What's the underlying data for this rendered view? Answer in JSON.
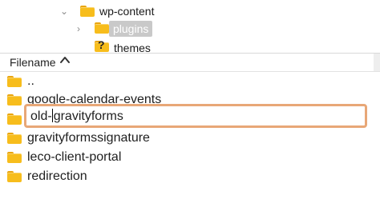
{
  "tree": {
    "items": [
      {
        "label": "wp-content",
        "icon": "folder-icon",
        "expanded": true
      },
      {
        "label": "plugins",
        "icon": "folder-icon",
        "selected": true
      },
      {
        "label": "themes",
        "icon": "question-folder-icon"
      }
    ]
  },
  "file_list": {
    "column_header": "Filename",
    "sort": "ascending",
    "rows": [
      {
        "name": ".."
      },
      {
        "name": "google-calendar-events"
      },
      {
        "name": "old-gravityforms",
        "editing": true
      },
      {
        "name": "gravityformssignature"
      },
      {
        "name": "leco-client-portal"
      },
      {
        "name": "redirection"
      }
    ]
  },
  "rename": {
    "before_caret": "old-",
    "after_caret": "gravityforms"
  },
  "colors": {
    "folder": "#f7bd1c",
    "selection": "#c9c9c9",
    "focus_ring": "#e8a777"
  }
}
